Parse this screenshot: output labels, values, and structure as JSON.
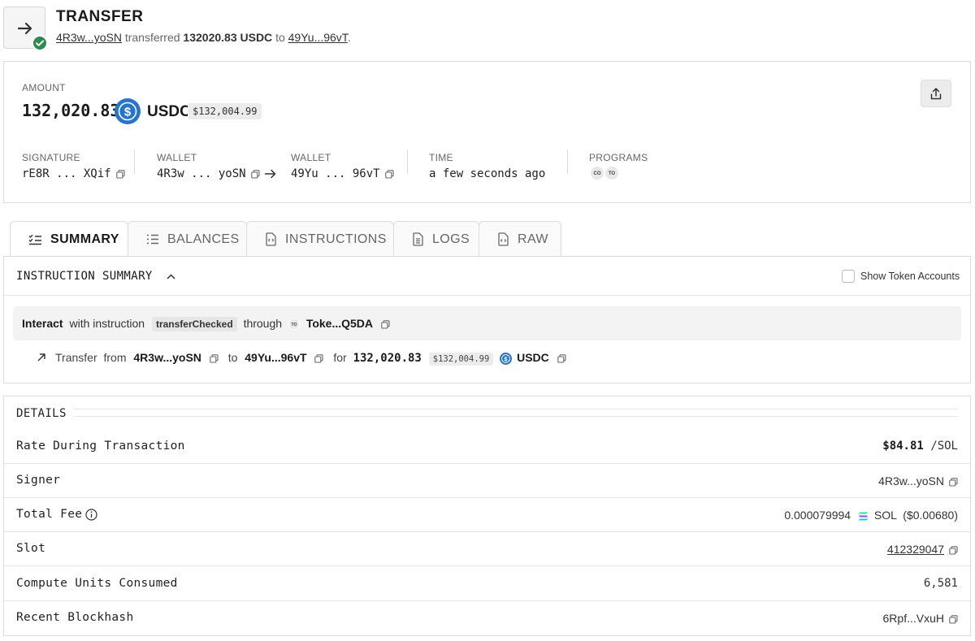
{
  "header": {
    "title": "TRANSFER",
    "from": "4R3w...yoSN",
    "verb": "transferred",
    "amount": "132020.83 USDC",
    "to_word": "to",
    "to": "49Yu...96vT",
    "period": "."
  },
  "amount_card": {
    "label": "AMOUNT",
    "value": "132,020.83",
    "currency": "USDC",
    "usd_value": "$132,004.99",
    "signature_label": "SIGNATURE",
    "signature": "rE8R ... XQif",
    "wallet_from_label": "WALLET",
    "wallet_from": "4R3w ... yoSN",
    "wallet_to_label": "WALLET",
    "wallet_to": "49Yu ... 96vT",
    "time_label": "TIME",
    "time": "a few seconds ago",
    "programs_label": "PROGRAMS",
    "programs": [
      "CO",
      "TO"
    ]
  },
  "tabs": [
    {
      "label": "SUMMARY",
      "icon": "list-check-icon",
      "active": true
    },
    {
      "label": "BALANCES",
      "icon": "list-icon",
      "active": false
    },
    {
      "label": "INSTRUCTIONS",
      "icon": "code-file-icon",
      "active": false
    },
    {
      "label": "LOGS",
      "icon": "document-icon",
      "active": false
    },
    {
      "label": "RAW",
      "icon": "code-doc-icon",
      "active": false
    }
  ],
  "summary": {
    "title": "INSTRUCTION SUMMARY",
    "show_token_accounts": "Show Token Accounts",
    "interact": "Interact",
    "with_instruction": "with instruction",
    "instruction": "transferChecked",
    "through": "through",
    "program_chip": "TO",
    "program": "Toke...Q5DA",
    "transfer_word": "Transfer",
    "from_word": "from",
    "from": "4R3w...yoSN",
    "to_word": "to",
    "to": "49Yu...96vT",
    "for_word": "for",
    "amount": "132,020.83",
    "usd": "$132,004.99",
    "currency": "USDC"
  },
  "details": {
    "title": "DETAILS",
    "rows": [
      {
        "label": "Rate During Transaction",
        "value_bold": "$84.81",
        "value": " /SOL"
      },
      {
        "label": "Signer",
        "value": "4R3w...yoSN"
      },
      {
        "label": "Total Fee",
        "value": "0.000079994",
        "unit": "SOL",
        "usd": "($0.00680)"
      },
      {
        "label": "Slot",
        "value": "412329047"
      },
      {
        "label": "Compute Units Consumed",
        "value": "6,581"
      },
      {
        "label": "Recent Blockhash",
        "value": "6Rpf...VxuH"
      }
    ]
  },
  "colors": {
    "success": "#2e8b4f",
    "usdc": "#2775ca",
    "border": "#dcdcdc"
  }
}
